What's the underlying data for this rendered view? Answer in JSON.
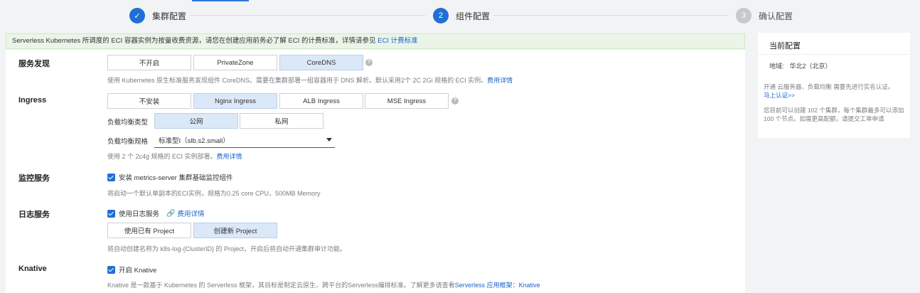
{
  "stepper": {
    "steps": [
      {
        "index": "",
        "label": "集群配置",
        "state": "done"
      },
      {
        "index": "2",
        "label": "组件配置",
        "state": "active"
      },
      {
        "index": "3",
        "label": "确认配置",
        "state": "pending"
      }
    ]
  },
  "notice": {
    "text": "Serverless Kubernetes 所调度的 ECI 容器实例为按量收费资源，请您在创建应用前务必了解 ECI 的计费标准，详情请参见 ",
    "link": "ECI 计费标准"
  },
  "service_discovery": {
    "label": "服务发现",
    "options": [
      "不开启",
      "PrivateZone",
      "CoreDNS"
    ],
    "selected": "CoreDNS",
    "desc": "使用 Kubernetes 原生标准服务发现组件 CoreDNS。需要在集群部署一组容器用于 DNS 解析。默认采用2个 2C 2Gi 规格的 ECI 实例。",
    "desc_link": "费用详情"
  },
  "ingress": {
    "label": "Ingress",
    "options": [
      "不安装",
      "Nginx Ingress",
      "ALB Ingress",
      "MSE Ingress"
    ],
    "selected": "Nginx Ingress",
    "lb_type_label": "负载均衡类型",
    "lb_type_options": [
      "公网",
      "私网"
    ],
    "lb_type_selected": "公网",
    "lb_spec_label": "负载均衡规格",
    "lb_spec_value": "标准型I（slb.s2.small）",
    "desc": "使用 2 个 2c4g 规格的 ECI 实例部署。",
    "desc_link": "费用详情"
  },
  "monitoring": {
    "label": "监控服务",
    "checkbox_label": "安装 metrics-server 集群基础监控组件",
    "checked": true,
    "desc": "将启动一个默认单副本的ECI实例，规格为0.25 core CPU，500MB Memory"
  },
  "logging": {
    "label": "日志服务",
    "checkbox_label": "使用日志服务",
    "checked": true,
    "link": "费用详情",
    "project_options": [
      "使用已有 Project",
      "创建新 Project"
    ],
    "project_selected": "创建新 Project",
    "desc": "将自动创建名称为 k8s-log-{ClusterID} 的 Project，开启后将自动开通集群审计功能。"
  },
  "knative": {
    "label": "Knative",
    "checkbox_label": "开启 Knative",
    "checked": true,
    "desc": "Knative 是一款基于 Kubernetes 的 Serverless 框架，其目标是制定云原生、跨平台的Serverless编排标准。了解更多请查看",
    "desc_link": "Serverless 应用框架：Knative"
  },
  "side": {
    "title": "当前配置",
    "region_label": "地域:",
    "region_value": "华北2（北京）",
    "verify_text": "开通 云服务器、负载均衡 需要先进行实名认证。",
    "verify_link": "马上认证>>",
    "quota_text": "您目前可以创建 102 个集群，每个集群最多可以添加 100 个节点。如需更高配额，请提交工单申请"
  },
  "colors": {
    "accent": "#1f6fd6",
    "link": "#1c63c8",
    "selected_bg": "#dbe8f8",
    "notice_bg": "#eaf5e8"
  }
}
